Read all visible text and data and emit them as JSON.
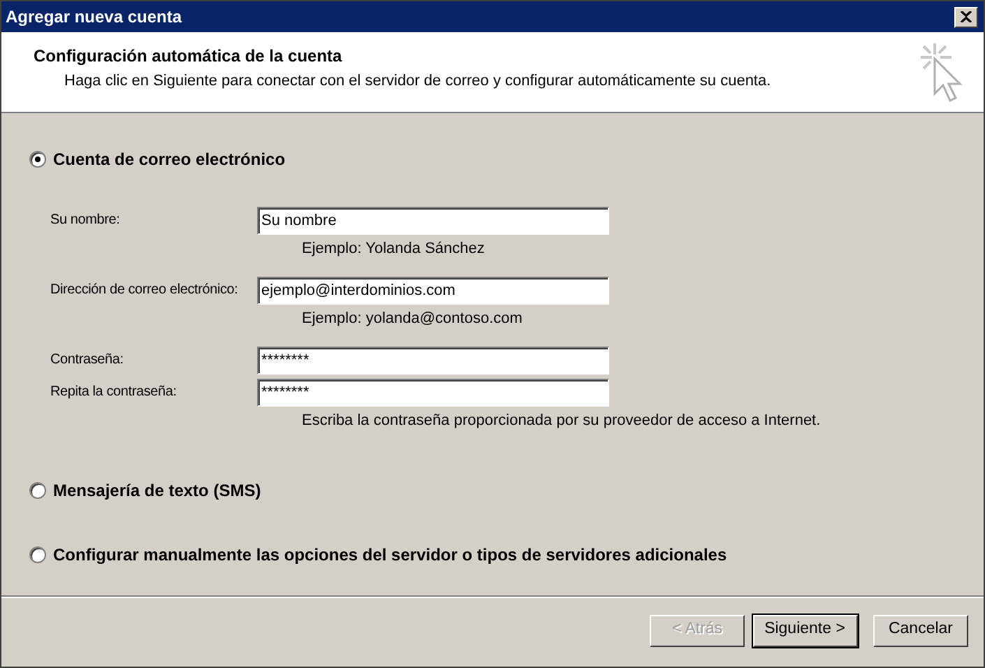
{
  "window": {
    "title": "Agregar nueva cuenta"
  },
  "header": {
    "title": "Configuración automática de la cuenta",
    "subtitle": "Haga clic en Siguiente para conectar con el servidor de correo y configurar automáticamente su cuenta."
  },
  "options": [
    {
      "label": "Cuenta de correo electrónico",
      "selected": true,
      "fields": [
        {
          "label": "Su nombre:",
          "value": "Su nombre",
          "hint": "Ejemplo: Yolanda Sánchez"
        },
        {
          "label": "Dirección de correo electrónico:",
          "value": "ejemplo@interdominios.com",
          "hint": "Ejemplo: yolanda@contoso.com"
        },
        {
          "label": "Contraseña:",
          "value": "********"
        },
        {
          "label": "Repita la contraseña:",
          "value": "********",
          "hint": "Escriba la contraseña proporcionada por su proveedor de acceso a Internet."
        }
      ]
    },
    {
      "label": "Mensajería de texto (SMS)",
      "selected": false
    },
    {
      "label": "Configurar manualmente las opciones del servidor o tipos de servidores adicionales",
      "selected": false
    }
  ],
  "buttons": [
    {
      "label": "< Atrás",
      "disabled": true,
      "default": false
    },
    {
      "label": "Siguiente >",
      "disabled": false,
      "default": true
    },
    {
      "label": "Cancelar",
      "disabled": false,
      "default": false
    }
  ]
}
